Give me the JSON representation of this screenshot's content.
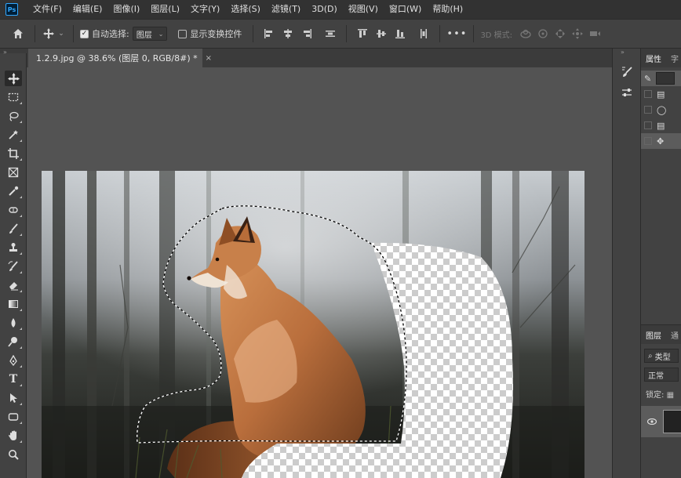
{
  "app": {
    "logo_text": "Ps",
    "menu": [
      "文件(F)",
      "编辑(E)",
      "图像(I)",
      "图层(L)",
      "文字(Y)",
      "选择(S)",
      "滤镜(T)",
      "3D(D)",
      "视图(V)",
      "窗口(W)",
      "帮助(H)"
    ]
  },
  "options_bar": {
    "auto_select_label": "自动选择:",
    "auto_select_checked": true,
    "auto_select_target": "图层",
    "show_transform_label": "显示变换控件",
    "show_transform_checked": false,
    "more": "•••",
    "mode_3d_label": "3D 模式:"
  },
  "document": {
    "tab_title": "1.2.9.jpg @ 38.6% (图层 0, RGB/8#) *",
    "close_glyph": "×"
  },
  "right_panel": {
    "tabs": [
      "属性",
      "字"
    ],
    "history_items": [
      "snapshot",
      "document",
      "lasso",
      "document",
      "move"
    ]
  },
  "layers_panel": {
    "tabs": [
      "图层",
      "通"
    ],
    "filter_label": "类型",
    "blend_mode": "正常",
    "lock_label": "锁定:",
    "visibility_glyph": "👁"
  },
  "icons": {
    "home": "home-icon",
    "move": "move-icon",
    "collapse": "»"
  },
  "colors": {
    "menubar": "#323232",
    "panel": "#424242",
    "workspace": "#535353",
    "accent": "#31a8ff"
  }
}
